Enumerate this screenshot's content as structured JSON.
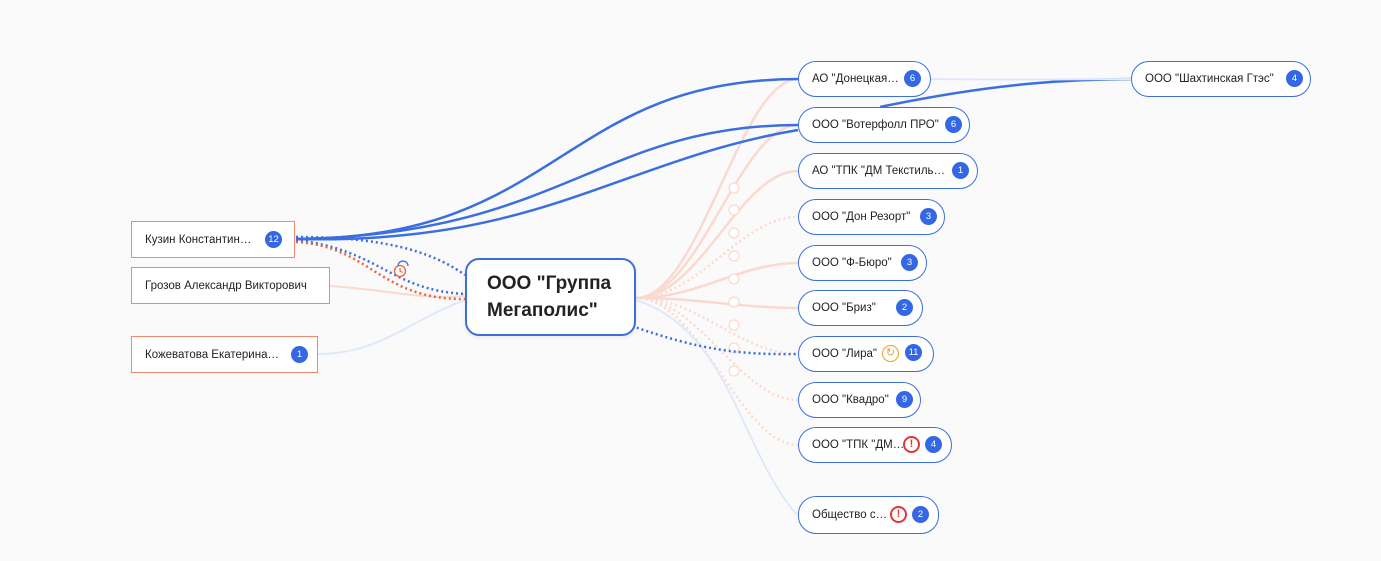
{
  "colors": {
    "ownership": "#3b6fe0",
    "person_border": "#ef8a6e",
    "management": "#e8643c",
    "faint_link": "#fcd9cf",
    "faint_blue": "#dfe9fb",
    "badge": "#3367e6",
    "warning": "#e3383a",
    "sync": "#e8a02c"
  },
  "center": {
    "label": "ООО \"Группа Мегаполис\""
  },
  "people": [
    {
      "label": "Кузин Константин…",
      "badge": "12"
    },
    {
      "label": "Грозов Александр Викторович",
      "badge": ""
    },
    {
      "label": "Кожеватова Екатерина…",
      "badge": "1"
    }
  ],
  "companies": [
    {
      "label": "АО \"Донецкая…",
      "badge": "6",
      "icon": ""
    },
    {
      "label": "ООО \"Вотерфолл ПРО\"",
      "badge": "6",
      "icon": ""
    },
    {
      "label": "АО \"ТПК \"ДМ Текстиль…",
      "badge": "1",
      "icon": ""
    },
    {
      "label": "ООО \"Дон Резорт\"",
      "badge": "3",
      "icon": ""
    },
    {
      "label": "ООО \"Ф-Бюро\"",
      "badge": "3",
      "icon": ""
    },
    {
      "label": "ООО \"Бриз\"",
      "badge": "2",
      "icon": ""
    },
    {
      "label": "ООО \"Лира\"",
      "badge": "11",
      "icon": "sync-icon"
    },
    {
      "label": "ООО \"Квадро\"",
      "badge": "9",
      "icon": ""
    },
    {
      "label": "ООО \"ТПК \"ДМ…",
      "badge": "4",
      "icon": "warning-icon"
    },
    {
      "label": "Общество с…",
      "badge": "2",
      "icon": "warning-icon"
    }
  ],
  "extra": {
    "label": "ООО \"Шахтинская Гтэс\"",
    "badge": "4"
  },
  "icons": {
    "warning_glyph": "!",
    "sync_glyph": "↻",
    "clock": "clock-icon"
  }
}
